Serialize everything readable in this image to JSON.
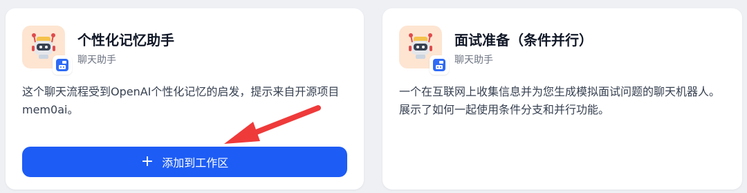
{
  "cards": [
    {
      "title": "个性化记忆助手",
      "subtitle": "聊天助手",
      "description": "这个聊天流程受到OpenAI个性化记忆的启发，提示来自开源项目mem0ai。",
      "add_button": {
        "icon": "+",
        "label": "添加到工作区"
      },
      "avatar_icon": "robot-icon",
      "badge_icon": "chat-bot-badge-icon"
    },
    {
      "title": "面试准备（条件并行）",
      "subtitle": "聊天助手",
      "description": "一个在互联网上收集信息并为您生成模拟面试问题的聊天机器人。展示了如何一起使用条件分支和并行功能。",
      "avatar_icon": "robot-icon",
      "badge_icon": "chat-bot-badge-icon"
    }
  ],
  "colors": {
    "page_bg": "#eef0f4",
    "card_bg": "#ffffff",
    "avatar_bg": "#fde5d2",
    "button_bg": "#1d5cf5",
    "badge_blue": "#2f6bf5",
    "annotation_arrow": "#ef3a3a"
  }
}
